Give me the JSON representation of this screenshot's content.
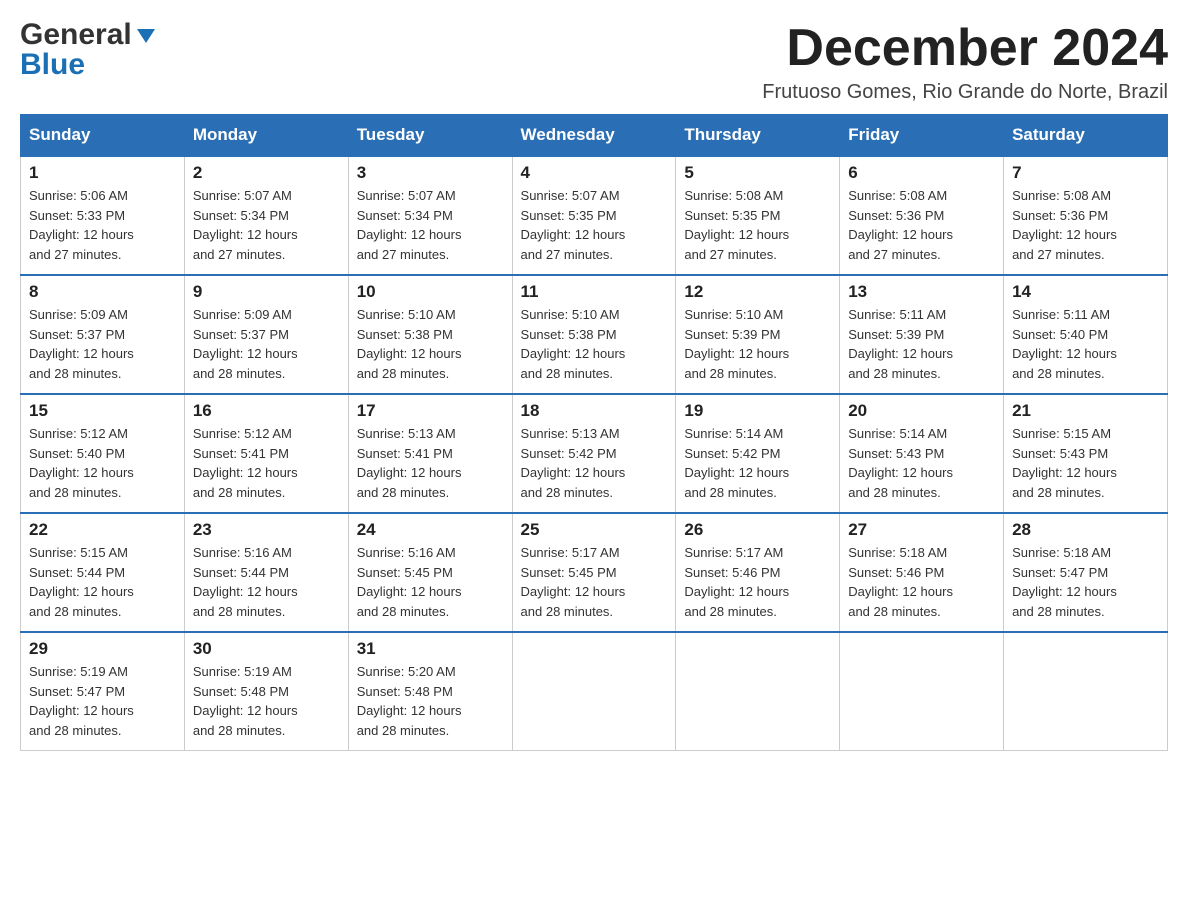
{
  "logo": {
    "line1": "General",
    "line2": "Blue"
  },
  "header": {
    "title": "December 2024",
    "subtitle": "Frutuoso Gomes, Rio Grande do Norte, Brazil"
  },
  "days_of_week": [
    "Sunday",
    "Monday",
    "Tuesday",
    "Wednesday",
    "Thursday",
    "Friday",
    "Saturday"
  ],
  "weeks": [
    [
      {
        "day": "1",
        "sunrise": "5:06 AM",
        "sunset": "5:33 PM",
        "daylight": "12 hours and 27 minutes."
      },
      {
        "day": "2",
        "sunrise": "5:07 AM",
        "sunset": "5:34 PM",
        "daylight": "12 hours and 27 minutes."
      },
      {
        "day": "3",
        "sunrise": "5:07 AM",
        "sunset": "5:34 PM",
        "daylight": "12 hours and 27 minutes."
      },
      {
        "day": "4",
        "sunrise": "5:07 AM",
        "sunset": "5:35 PM",
        "daylight": "12 hours and 27 minutes."
      },
      {
        "day": "5",
        "sunrise": "5:08 AM",
        "sunset": "5:35 PM",
        "daylight": "12 hours and 27 minutes."
      },
      {
        "day": "6",
        "sunrise": "5:08 AM",
        "sunset": "5:36 PM",
        "daylight": "12 hours and 27 minutes."
      },
      {
        "day": "7",
        "sunrise": "5:08 AM",
        "sunset": "5:36 PM",
        "daylight": "12 hours and 27 minutes."
      }
    ],
    [
      {
        "day": "8",
        "sunrise": "5:09 AM",
        "sunset": "5:37 PM",
        "daylight": "12 hours and 28 minutes."
      },
      {
        "day": "9",
        "sunrise": "5:09 AM",
        "sunset": "5:37 PM",
        "daylight": "12 hours and 28 minutes."
      },
      {
        "day": "10",
        "sunrise": "5:10 AM",
        "sunset": "5:38 PM",
        "daylight": "12 hours and 28 minutes."
      },
      {
        "day": "11",
        "sunrise": "5:10 AM",
        "sunset": "5:38 PM",
        "daylight": "12 hours and 28 minutes."
      },
      {
        "day": "12",
        "sunrise": "5:10 AM",
        "sunset": "5:39 PM",
        "daylight": "12 hours and 28 minutes."
      },
      {
        "day": "13",
        "sunrise": "5:11 AM",
        "sunset": "5:39 PM",
        "daylight": "12 hours and 28 minutes."
      },
      {
        "day": "14",
        "sunrise": "5:11 AM",
        "sunset": "5:40 PM",
        "daylight": "12 hours and 28 minutes."
      }
    ],
    [
      {
        "day": "15",
        "sunrise": "5:12 AM",
        "sunset": "5:40 PM",
        "daylight": "12 hours and 28 minutes."
      },
      {
        "day": "16",
        "sunrise": "5:12 AM",
        "sunset": "5:41 PM",
        "daylight": "12 hours and 28 minutes."
      },
      {
        "day": "17",
        "sunrise": "5:13 AM",
        "sunset": "5:41 PM",
        "daylight": "12 hours and 28 minutes."
      },
      {
        "day": "18",
        "sunrise": "5:13 AM",
        "sunset": "5:42 PM",
        "daylight": "12 hours and 28 minutes."
      },
      {
        "day": "19",
        "sunrise": "5:14 AM",
        "sunset": "5:42 PM",
        "daylight": "12 hours and 28 minutes."
      },
      {
        "day": "20",
        "sunrise": "5:14 AM",
        "sunset": "5:43 PM",
        "daylight": "12 hours and 28 minutes."
      },
      {
        "day": "21",
        "sunrise": "5:15 AM",
        "sunset": "5:43 PM",
        "daylight": "12 hours and 28 minutes."
      }
    ],
    [
      {
        "day": "22",
        "sunrise": "5:15 AM",
        "sunset": "5:44 PM",
        "daylight": "12 hours and 28 minutes."
      },
      {
        "day": "23",
        "sunrise": "5:16 AM",
        "sunset": "5:44 PM",
        "daylight": "12 hours and 28 minutes."
      },
      {
        "day": "24",
        "sunrise": "5:16 AM",
        "sunset": "5:45 PM",
        "daylight": "12 hours and 28 minutes."
      },
      {
        "day": "25",
        "sunrise": "5:17 AM",
        "sunset": "5:45 PM",
        "daylight": "12 hours and 28 minutes."
      },
      {
        "day": "26",
        "sunrise": "5:17 AM",
        "sunset": "5:46 PM",
        "daylight": "12 hours and 28 minutes."
      },
      {
        "day": "27",
        "sunrise": "5:18 AM",
        "sunset": "5:46 PM",
        "daylight": "12 hours and 28 minutes."
      },
      {
        "day": "28",
        "sunrise": "5:18 AM",
        "sunset": "5:47 PM",
        "daylight": "12 hours and 28 minutes."
      }
    ],
    [
      {
        "day": "29",
        "sunrise": "5:19 AM",
        "sunset": "5:47 PM",
        "daylight": "12 hours and 28 minutes."
      },
      {
        "day": "30",
        "sunrise": "5:19 AM",
        "sunset": "5:48 PM",
        "daylight": "12 hours and 28 minutes."
      },
      {
        "day": "31",
        "sunrise": "5:20 AM",
        "sunset": "5:48 PM",
        "daylight": "12 hours and 28 minutes."
      },
      null,
      null,
      null,
      null
    ]
  ],
  "labels": {
    "sunrise": "Sunrise:",
    "sunset": "Sunset:",
    "daylight": "Daylight:"
  }
}
